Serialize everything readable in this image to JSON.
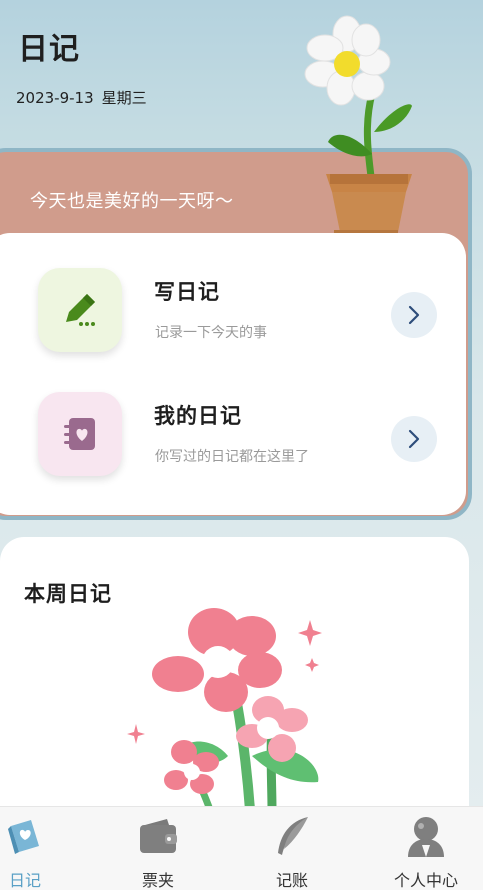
{
  "header": {
    "title": "日记",
    "date": "2023-9-13",
    "weekday": "星期三"
  },
  "banner": {
    "text": "今天也是美好的一天呀～"
  },
  "actions": [
    {
      "title": "写日记",
      "subtitle": "记录一下今天的事",
      "icon": "pencil-icon"
    },
    {
      "title": "我的日记",
      "subtitle": "你写过的日记都在这里了",
      "icon": "notebook-heart-icon"
    }
  ],
  "week": {
    "title": "本周日记"
  },
  "nav": [
    {
      "label": "日记",
      "icon": "diary-book-icon",
      "active": true
    },
    {
      "label": "票夹",
      "icon": "wallet-icon",
      "active": false
    },
    {
      "label": "记账",
      "icon": "feather-icon",
      "active": false
    },
    {
      "label": "个人中心",
      "icon": "user-icon",
      "active": false
    }
  ],
  "colors": {
    "accent": "#5aa0c6",
    "banner": "#d09c8c",
    "banner_border": "#8fb6c6",
    "pencil_green": "#4a8a1c",
    "notebook_purple": "#9a6a8e"
  }
}
